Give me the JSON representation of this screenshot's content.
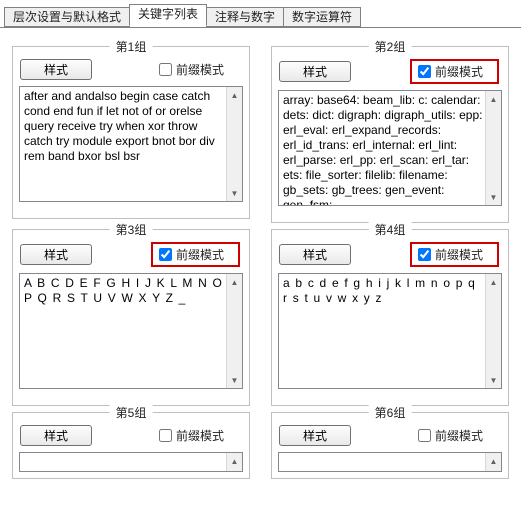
{
  "tabs": [
    {
      "label": "层次设置与默认格式"
    },
    {
      "label": "关键字列表"
    },
    {
      "label": "注释与数字"
    },
    {
      "label": "数字运算符"
    }
  ],
  "active_tab_index": 1,
  "groups": {
    "g1": {
      "title": "第1组",
      "style_label": "样式",
      "prefix_label": "前缀模式",
      "prefix_checked": false,
      "prefix_highlight": false,
      "keywords": "after and andalso begin case catch cond end fun if let not of or orelse query receive try when xor throw catch try module export bnot bor div rem band bxor bsl bsr",
      "wide": false
    },
    "g2": {
      "title": "第2组",
      "style_label": "样式",
      "prefix_label": "前缀模式",
      "prefix_checked": true,
      "prefix_highlight": true,
      "keywords": "array: base64: beam_lib: c: calendar: dets: dict: digraph: digraph_utils: epp: erl_eval: erl_expand_records: erl_id_trans: erl_internal: erl_lint: erl_parse: erl_pp: erl_scan: erl_tar: ets: file_sorter: filelib: filename: gb_sets: gb_trees: gen_event: gen_fsm:",
      "wide": false
    },
    "g3": {
      "title": "第3组",
      "style_label": "样式",
      "prefix_label": "前缀模式",
      "prefix_checked": true,
      "prefix_highlight": true,
      "keywords": "A B C D E F G H I J K L M N O P Q R S T U V W X Y Z _",
      "wide": true
    },
    "g4": {
      "title": "第4组",
      "style_label": "样式",
      "prefix_label": "前缀模式",
      "prefix_checked": true,
      "prefix_highlight": true,
      "keywords": "a b c d e f g h i j k l m n o p q r s t u v w x y z",
      "wide": true
    },
    "g5": {
      "title": "第5组",
      "style_label": "样式",
      "prefix_label": "前缀模式",
      "prefix_checked": false,
      "prefix_highlight": false,
      "keywords": "",
      "wide": false
    },
    "g6": {
      "title": "第6组",
      "style_label": "样式",
      "prefix_label": "前缀模式",
      "prefix_checked": false,
      "prefix_highlight": false,
      "keywords": "",
      "wide": false
    }
  }
}
